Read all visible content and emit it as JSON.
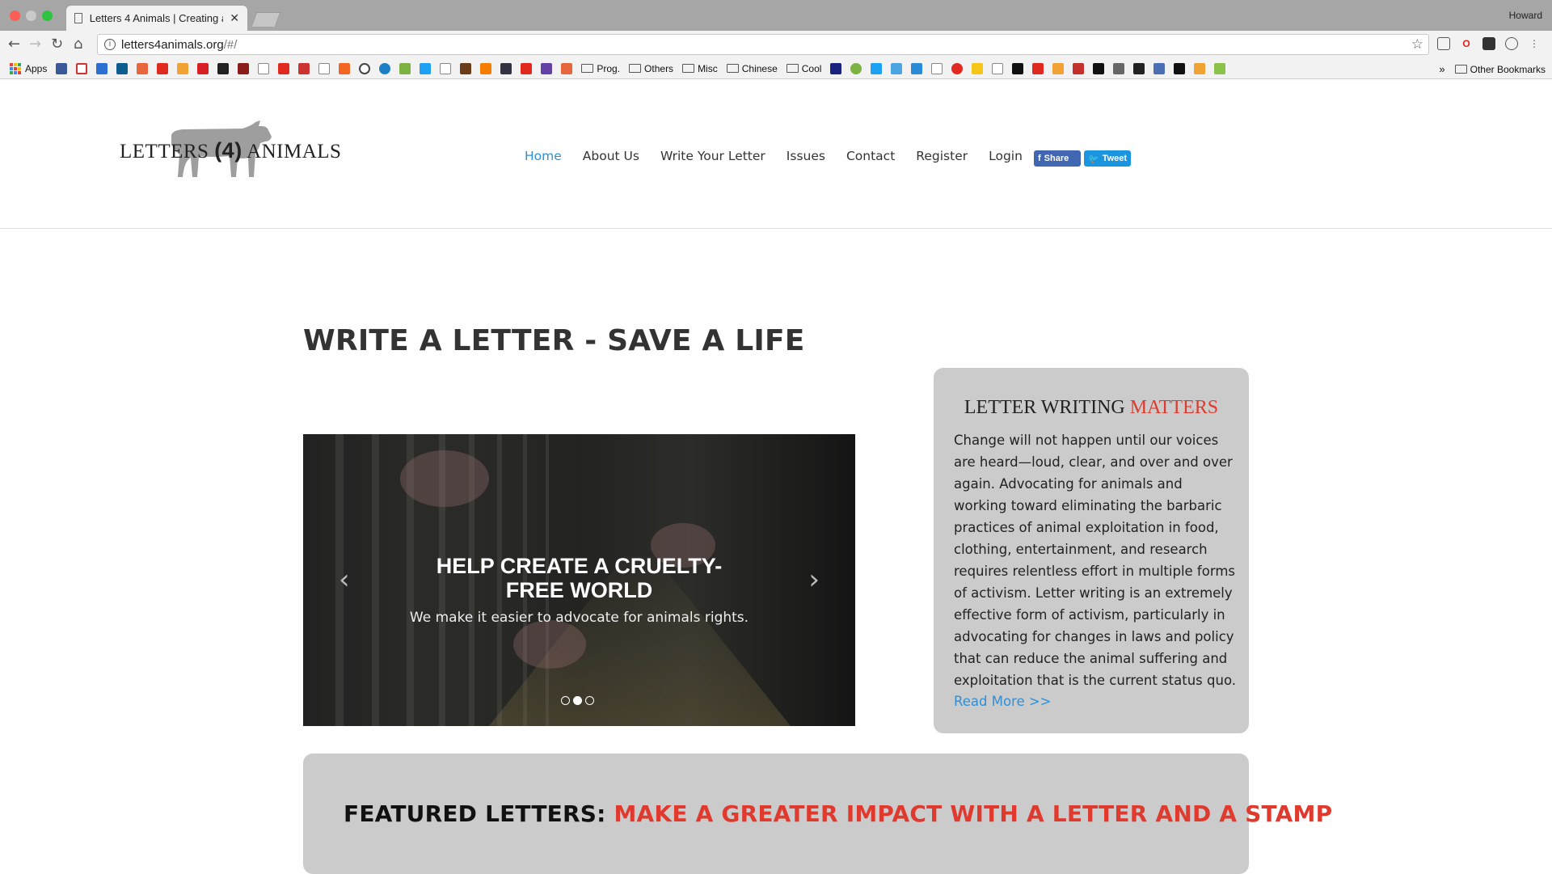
{
  "browser": {
    "tab_title": "Letters 4 Animals | Creating a",
    "tab_close": "✕",
    "profile_name": "Howard",
    "url_host": "letters4animals.org",
    "url_path": "/#/",
    "info_glyph": "i",
    "bookmarks": {
      "apps_label": "Apps",
      "folders": [
        "Prog.",
        "Others",
        "Misc",
        "Chinese",
        "Cool"
      ],
      "other_bookmarks": "Other Bookmarks",
      "overflow": "»"
    }
  },
  "site": {
    "logo": {
      "before": "LETTERS ",
      "num": "(4)",
      "after": " ANIMALS"
    },
    "nav": [
      "Home",
      "About Us",
      "Write Your Letter",
      "Issues",
      "Contact",
      "Register",
      "Login"
    ],
    "share_label": "Share",
    "tweet_label": "Tweet",
    "fb_glyph": "f",
    "tw_glyph": "🐦"
  },
  "main": {
    "title": "WRITE A LETTER - SAVE A LIFE",
    "slide": {
      "heading_line1": "HELP CREATE A CRUELTY-",
      "heading_line2": "FREE WORLD",
      "subtitle": "We make it easier to advocate for animals rights.",
      "prev": "‹",
      "next": "›",
      "active_index": 1
    },
    "letter_box": {
      "title_plain": "LETTER WRITING ",
      "title_accent": "MATTERS",
      "body": "Change will not happen until our voices are heard—loud, clear, and over and over again. Advocating for animals and working toward eliminating the barbaric practices of animal exploitation in food, clothing, entertainment, and research requires relentless effort in multiple forms of activism. Letter writing is an extremely effective form of activism, particularly in advocating for changes in laws and policy that can reduce the animal suffering and exploitation that is the current status quo.",
      "read_more": "Read More >>"
    },
    "featured": {
      "label": "FEATURED LETTERS: ",
      "accent": "MAKE A GREATER IMPACT WITH A LETTER AND A STAMP"
    }
  },
  "colors": {
    "accent_blue": "#2f8fd6",
    "accent_red": "#e03a2e",
    "box_gray": "#cbcbcb"
  }
}
